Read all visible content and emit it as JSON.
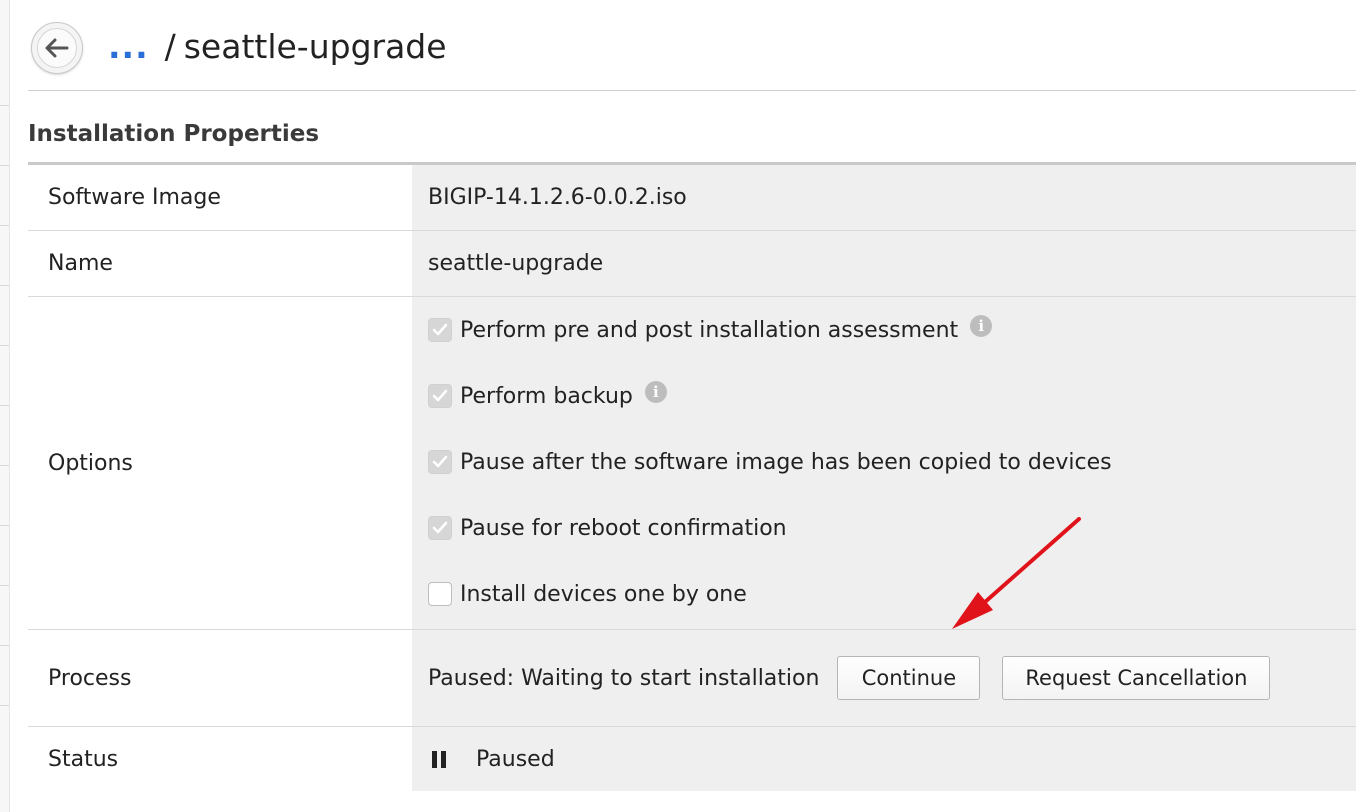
{
  "header": {
    "back_icon": "arrow-left-icon",
    "breadcrumb_link": "...",
    "breadcrumb_separator": "/",
    "breadcrumb_current": "seattle-upgrade"
  },
  "section": {
    "title": "Installation Properties"
  },
  "properties": {
    "software_image": {
      "label": "Software Image",
      "value": "BIGIP-14.1.2.6-0.0.2.iso"
    },
    "name": {
      "label": "Name",
      "value": "seattle-upgrade"
    },
    "options": {
      "label": "Options",
      "items": [
        {
          "label": "Perform pre and post installation assessment",
          "checked": true,
          "disabled": true,
          "info": "info-icon"
        },
        {
          "label": "Perform backup",
          "checked": true,
          "disabled": true,
          "info": "info-icon"
        },
        {
          "label": "Pause after the software image has been copied to devices",
          "checked": true,
          "disabled": true
        },
        {
          "label": "Pause for reboot confirmation",
          "checked": true,
          "disabled": true
        },
        {
          "label": "Install devices one by one",
          "checked": false,
          "disabled": false
        }
      ]
    },
    "process": {
      "label": "Process",
      "text": "Paused: Waiting to start installation",
      "continue_label": "Continue",
      "cancel_label": "Request Cancellation"
    },
    "status": {
      "label": "Status",
      "icon": "pause-icon",
      "value": "Paused"
    }
  },
  "annotation": {
    "arrow_icon": "red-arrow-annotation",
    "color": "#e0131a"
  }
}
